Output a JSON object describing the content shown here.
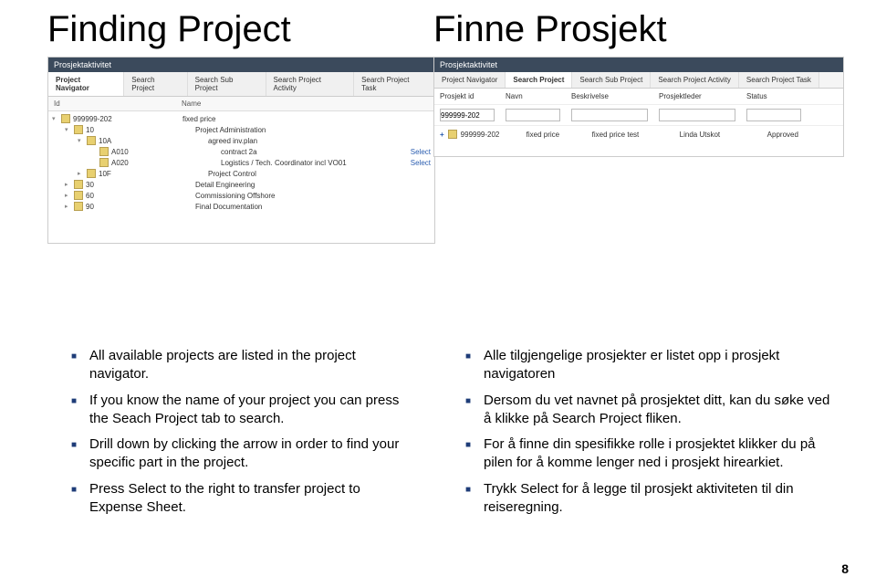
{
  "headings": {
    "left": "Finding Project",
    "right": "Finne Prosjekt"
  },
  "appTitle": "Prosjektaktivitet",
  "tabs": [
    "Project Navigator",
    "Search Project",
    "Search Sub Project",
    "Search Project Activity",
    "Search Project Task"
  ],
  "leftShot": {
    "activeTab": 0,
    "cols": {
      "id": "Id",
      "name": "Name"
    },
    "rows": [
      {
        "indent": 0,
        "arrow": "▾",
        "id": "999999-202",
        "name": "fixed price"
      },
      {
        "indent": 1,
        "arrow": "▾",
        "id": "10",
        "name": "Project Administration"
      },
      {
        "indent": 2,
        "arrow": "▾",
        "id": "10A",
        "name": "agreed inv.plan"
      },
      {
        "indent": 3,
        "arrow": "",
        "id": "A010",
        "name": "contract 2a",
        "select": "Select"
      },
      {
        "indent": 3,
        "arrow": "",
        "id": "A020",
        "name": "Logistics / Tech. Coordinator incl VO01",
        "select": "Select"
      },
      {
        "indent": 2,
        "arrow": "▸",
        "id": "10F",
        "name": "Project Control"
      },
      {
        "indent": 1,
        "arrow": "▸",
        "id": "30",
        "name": "Detail Engineering"
      },
      {
        "indent": 1,
        "arrow": "▸",
        "id": "60",
        "name": "Commissioning Offshore"
      },
      {
        "indent": 1,
        "arrow": "▸",
        "id": "90",
        "name": "Final Documentation"
      }
    ]
  },
  "rightShot": {
    "activeTab": 1,
    "cols": {
      "id": "Prosjekt id",
      "name": "Navn",
      "desc": "Beskrivelse",
      "leader": "Prosjektleder",
      "status": "Status"
    },
    "inputVal": "999999-202",
    "result": {
      "id": "999999-202",
      "name": "fixed price",
      "desc": "fixed price test",
      "leader": "Linda Utskot",
      "status": "Approved"
    }
  },
  "bulletsLeft": [
    "All available projects are listed in the project navigator.",
    "If you know the name of your project you can press the Seach Project tab to search.",
    "Drill down by clicking the arrow in order to find your specific part in the project.",
    "Press Select to the right to transfer project to Expense Sheet."
  ],
  "bulletsRight": [
    "Alle tilgjengelige prosjekter er listet opp i prosjekt navigatoren",
    "Dersom du vet navnet på prosjektet ditt, kan du søke ved å klikke på Search Project fliken.",
    "For å finne din spesifikke rolle i prosjektet klikker du på pilen for å komme lenger ned i prosjekt hirearkiet.",
    "Trykk Select for å legge til prosjekt aktiviteten til din reiseregning."
  ],
  "pageNumber": "8"
}
